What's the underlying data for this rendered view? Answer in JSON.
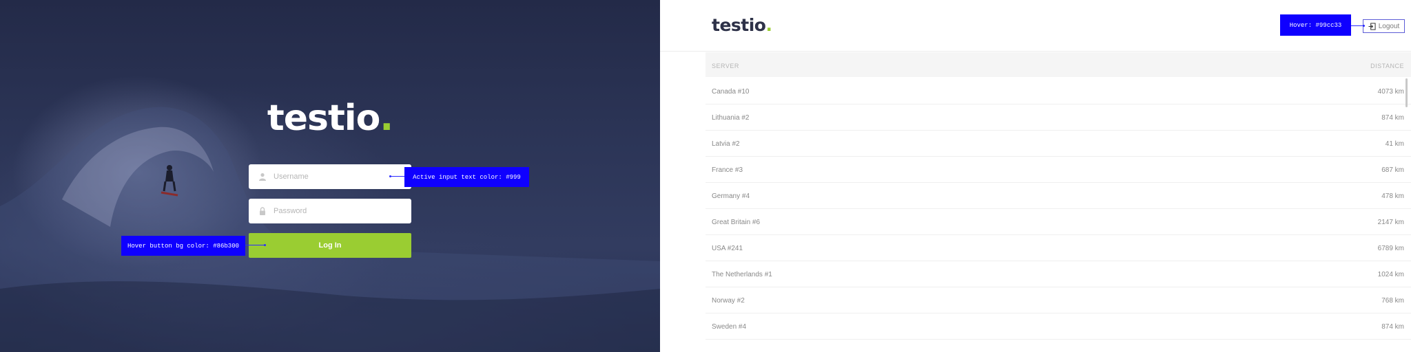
{
  "login": {
    "logo": "testio",
    "logo_dot": ".",
    "username_placeholder": "Username",
    "password_placeholder": "Password",
    "login_label": "Log In"
  },
  "annotations": {
    "input_note": "Active input text color: #999",
    "button_note": "Hover button bg color: #86b300",
    "logout_note": "Hover: #99cc33"
  },
  "app": {
    "logo": "testio",
    "logo_dot": ".",
    "logout_label": "Logout",
    "columns": {
      "server": "SERVER",
      "distance": "DISTANCE"
    },
    "servers": [
      {
        "name": "Canada #10",
        "distance": "4073 km"
      },
      {
        "name": "Lithuania #2",
        "distance": "874 km"
      },
      {
        "name": "Latvia #2",
        "distance": "41 km"
      },
      {
        "name": "France #3",
        "distance": "687 km"
      },
      {
        "name": "Germany #4",
        "distance": "478 km"
      },
      {
        "name": "Great Britain #6",
        "distance": "2147 km"
      },
      {
        "name": "USA #241",
        "distance": "6789 km"
      },
      {
        "name": "The Netherlands #1",
        "distance": "1024 km"
      },
      {
        "name": "Norway #2",
        "distance": "768 km"
      },
      {
        "name": "Sweden #4",
        "distance": "874 km"
      }
    ]
  },
  "colors": {
    "accent": "#9acd32",
    "annotation": "#0f00ff",
    "brand_dark": "#2d3148"
  }
}
